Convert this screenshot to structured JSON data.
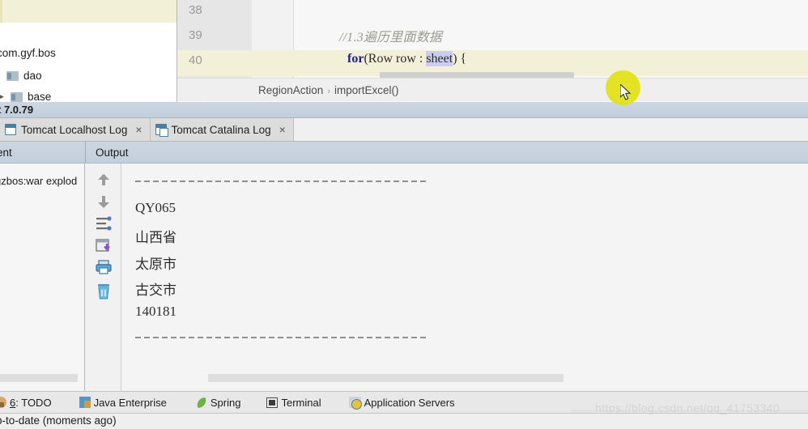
{
  "project_tree": {
    "package_label": "com.gyf.bos",
    "items": [
      {
        "label": "dao",
        "icon": "folder-icon"
      },
      {
        "label": "base",
        "icon": "folder-icon"
      }
    ]
  },
  "editor": {
    "line_numbers": [
      "38",
      "39",
      "40"
    ],
    "lines": [
      {
        "type": "comment",
        "text": "//1.3遍历里面数据"
      },
      {
        "type": "code",
        "prefix": "for",
        "middle": "(Row row : ",
        "selected": "sheet",
        "suffix": ") {"
      }
    ],
    "breadcrumb": {
      "parts": [
        "RegionAction",
        "importExcel()"
      ],
      "separator": "›"
    }
  },
  "server": {
    "version_label": "t 7.0.79"
  },
  "tabs": [
    {
      "label": "Tomcat Localhost Log",
      "close": "×",
      "icon": "log-tab-icon"
    },
    {
      "label": "Tomcat Catalina Log",
      "close": "×",
      "icon": "log-tab-icon"
    }
  ],
  "console_header": {
    "left_label": "ent",
    "right_label": "Output"
  },
  "deployment": {
    "item_label": "gzbos:war explod"
  },
  "console_toolbar": [
    {
      "name": "scroll-up-icon",
      "title": "Up the Stack Trace"
    },
    {
      "name": "scroll-down-icon",
      "title": "Down the Stack Trace"
    },
    {
      "name": "soft-wrap-icon",
      "title": "Use Soft Wraps"
    },
    {
      "name": "scroll-to-end-icon",
      "title": "Scroll to End"
    },
    {
      "name": "print-icon",
      "title": "Print"
    },
    {
      "name": "clear-all-icon",
      "title": "Clear All"
    }
  ],
  "console_output": {
    "separator_top": "----------------------------------------",
    "lines": [
      "QY065",
      "山西省",
      "太原市",
      "古交市",
      "140181"
    ],
    "separator_bottom": "----------------------------------------"
  },
  "tool_bar": [
    {
      "num": "6",
      "sep": ": ",
      "label": "TODO",
      "icon": "todo-icon"
    },
    {
      "label": "Java Enterprise",
      "icon": "java-enterprise-icon"
    },
    {
      "label": "Spring",
      "icon": "spring-icon"
    },
    {
      "label": "Terminal",
      "icon": "terminal-icon"
    },
    {
      "label": "Application Servers",
      "icon": "application-servers-icon"
    }
  ],
  "status": {
    "text": "p-to-date (moments ago)"
  },
  "watermark": {
    "text": "https://blog.csdn.net/qq_41753340"
  },
  "colors": {
    "selection": "#ccccf0",
    "line_highlight": "#f2f1d8",
    "keyword": "#1d1d8c",
    "comment": "#9b9b93",
    "cursor_glow": "#e2e211",
    "title_bar": "#c7d2de"
  }
}
